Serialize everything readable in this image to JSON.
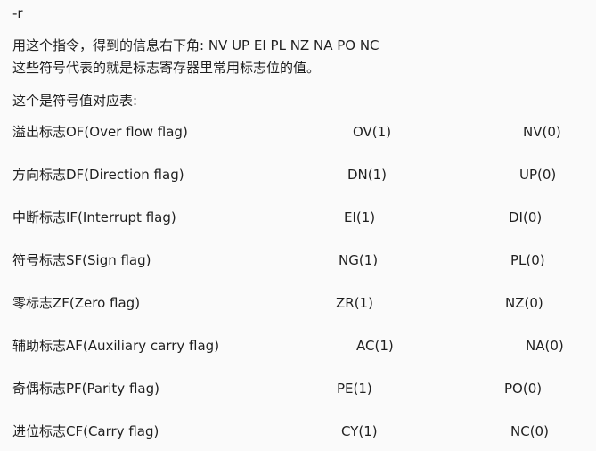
{
  "command": "-r",
  "intro_line1": "用这个指令，得到的信息右下角:  NV   UP   EI   PL   NZ   NA   PO   NC",
  "intro_line2": "这些符号代表的就是标志寄存器里常用标志位的值。",
  "table_caption": "这个是符号值对应表:",
  "flags": [
    {
      "name": "溢出标志OF(Over flow flag)",
      "set": "OV(1)",
      "clear": "NV(0)"
    },
    {
      "name": "方向标志DF(Direction flag)",
      "set": "DN(1)",
      "clear": "UP(0)"
    },
    {
      "name": "中断标志IF(Interrupt flag)",
      "set": "EI(1)",
      "clear": "DI(0)"
    },
    {
      "name": "符号标志SF(Sign flag)",
      "set": "NG(1)",
      "clear": "PL(0)"
    },
    {
      "name": "零标志ZF(Zero flag)",
      "set": "ZR(1)",
      "clear": "NZ(0)"
    },
    {
      "name": "辅助标志AF(Auxiliary carry flag)",
      "set": "AC(1)",
      "clear": "NA(0)"
    },
    {
      "name": "奇偶标志PF(Parity flag)",
      "set": "PE(1)",
      "clear": "PO(0)"
    },
    {
      "name": "进位标志CF(Carry flag)",
      "set": "CY(1)",
      "clear": "NC(0)"
    }
  ]
}
